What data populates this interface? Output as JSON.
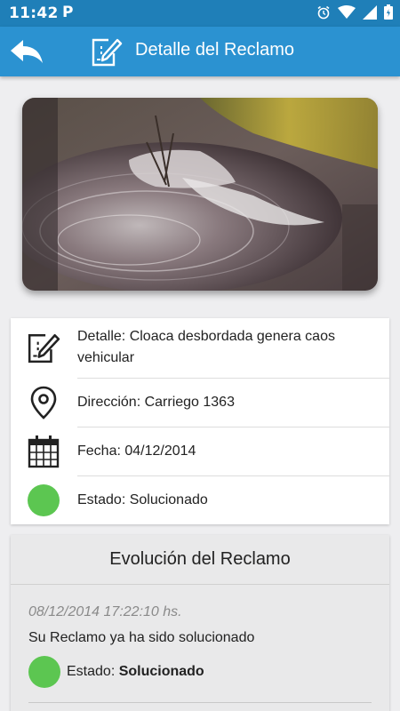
{
  "status_bar": {
    "time": "11:42",
    "notification": "P"
  },
  "app_bar": {
    "title": "Detalle del Reclamo",
    "back_icon": "back-arrow-icon",
    "title_icon": "edit-document-icon"
  },
  "details": {
    "detalle": "Detalle: Cloaca desbordada genera caos vehicular",
    "direccion": "Dirección: Carriego 1363",
    "fecha": "Fecha: 04/12/2014",
    "estado": "Estado: Solucionado",
    "estado_color": "#5cc651"
  },
  "evolucion": {
    "title": "Evolución del Reclamo",
    "entries": [
      {
        "datetime": "08/12/2014 17:22:10 hs.",
        "message": "Su Reclamo ya ha sido solucionado",
        "estado_label": "Estado: ",
        "estado_value": "Solucionado"
      }
    ]
  },
  "colors": {
    "primary": "#2b92d1",
    "status_bar": "#1f7fb8",
    "solved": "#5cc651"
  }
}
